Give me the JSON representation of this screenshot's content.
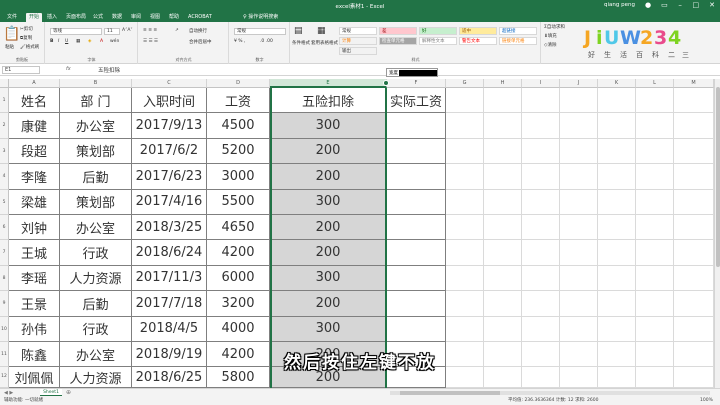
{
  "window": {
    "title": "excel素材1 - Excel",
    "user": "qiang peng",
    "accent": "#217346"
  },
  "tabs": [
    "文件",
    "开始",
    "插入",
    "页面布局",
    "公式",
    "数据",
    "审阅",
    "视图",
    "帮助",
    "ACROBAT"
  ],
  "active_tab": "开始",
  "tell_me": "操作说明搜索",
  "ribbon": {
    "clipboard": {
      "paste": "粘贴",
      "cut": "剪切",
      "copy": "复制",
      "format_painter": "格式刷",
      "label": "剪贴板"
    },
    "font": {
      "name": "等线",
      "size": "11",
      "label": "字体"
    },
    "alignment": {
      "wrap": "自动换行",
      "merge": "合并后居中",
      "label": "对齐方式"
    },
    "number": {
      "format": "常规",
      "label": "数字"
    },
    "styles": {
      "conditional": "条件格式",
      "table": "套用表格格式",
      "cells": [
        {
          "text": "常规",
          "bg": "#ffffff",
          "fg": "#333333"
        },
        {
          "text": "差",
          "bg": "#ffc7ce",
          "fg": "#9c0006"
        },
        {
          "text": "好",
          "bg": "#c6efce",
          "fg": "#006100"
        },
        {
          "text": "适中",
          "bg": "#ffeb9c",
          "fg": "#9c5700"
        },
        {
          "text": "超链接",
          "bg": "#ffffff",
          "fg": "#0563c1"
        },
        {
          "text": "计算",
          "bg": "#f2f2f2",
          "fg": "#fa7d00"
        },
        {
          "text": "检查单元格",
          "bg": "#a5a5a5",
          "fg": "#ffffff"
        },
        {
          "text": "解释性文本",
          "bg": "#ffffff",
          "fg": "#7f7f7f"
        },
        {
          "text": "警告文本",
          "bg": "#ffffff",
          "fg": "#ff0000"
        },
        {
          "text": "链接单元格",
          "bg": "#ffffff",
          "fg": "#fa7d00"
        },
        {
          "text": "输出",
          "bg": "#f2f2f2",
          "fg": "#3f3f3f"
        }
      ],
      "label": "样式"
    },
    "cells_group": {
      "insert": "插入",
      "delete": "删除",
      "format": "格式"
    },
    "editing": {
      "autosum": "自动求和",
      "fill": "填充",
      "clear": "清除"
    }
  },
  "formula_bar": {
    "name_box": "E1",
    "fx": "fx",
    "content": "五险扣除",
    "tooltip_label": "宽度"
  },
  "columns": [
    "A",
    "B",
    "C",
    "D",
    "E",
    "F",
    "G",
    "H",
    "I",
    "J",
    "K",
    "L",
    "M",
    "N",
    "O",
    "P"
  ],
  "rows": [
    "1",
    "2",
    "3",
    "4",
    "5",
    "6",
    "7",
    "8",
    "9",
    "10",
    "11",
    "12"
  ],
  "table": {
    "headers": [
      "姓名",
      "部  门",
      "入职时间",
      "工资",
      "五险扣除",
      "实际工资"
    ],
    "data": [
      [
        "康健",
        "办公室",
        "2017/9/13",
        "4500",
        "300",
        ""
      ],
      [
        "段超",
        "策划部",
        "2017/6/2",
        "5200",
        "200",
        ""
      ],
      [
        "李隆",
        "后勤",
        "2017/6/23",
        "3000",
        "200",
        ""
      ],
      [
        "梁雄",
        "策划部",
        "2017/4/16",
        "5500",
        "300",
        ""
      ],
      [
        "刘钟",
        "办公室",
        "2018/3/25",
        "4650",
        "200",
        ""
      ],
      [
        "王城",
        "行政",
        "2018/6/24",
        "4200",
        "200",
        ""
      ],
      [
        "李瑶",
        "人力资源",
        "2017/11/3",
        "6000",
        "300",
        ""
      ],
      [
        "王景",
        "后勤",
        "2017/7/18",
        "3200",
        "200",
        ""
      ],
      [
        "孙伟",
        "行政",
        "2018/4/5",
        "4000",
        "300",
        ""
      ],
      [
        "陈鑫",
        "办公室",
        "2018/9/19",
        "4200",
        "200",
        ""
      ],
      [
        "刘佩佩",
        "人力资源",
        "2018/6/25",
        "5800",
        "200",
        ""
      ]
    ]
  },
  "sheet_tab": "Sheet1",
  "status": {
    "left": "辅助功能: 一切就绪",
    "stats": "平均值: 236.3636364   计数: 12   求和: 2600",
    "zoom": "100%"
  },
  "subtitle": "然后按住左键不放"
}
